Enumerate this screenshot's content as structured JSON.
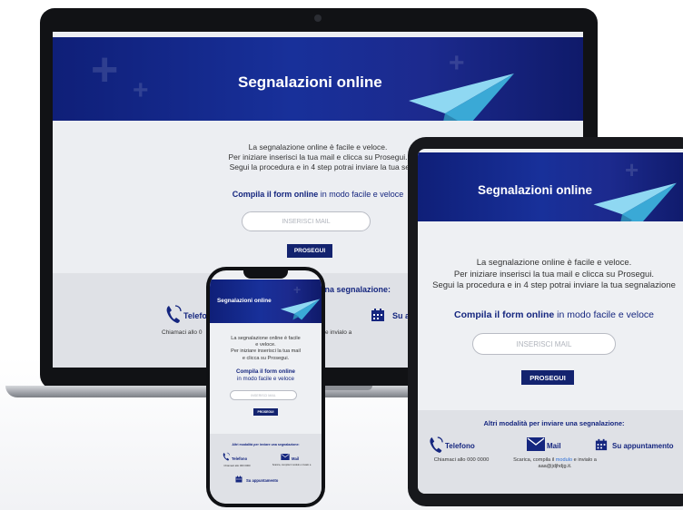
{
  "page": {
    "title": "Segnalazioni online",
    "intro_line1": "La segnalazione online è facile e veloce.",
    "intro_line2": "Per iniziare inserisci la tua mail e clicca su Prosegui.",
    "intro_line3_laptop": "Segui la procedura e in 4 step potrai inviare la tua segnalazion",
    "intro_line3": "Segui la procedura e in 4 step potrai inviare la tua segnalazione",
    "cta_bold": "Compila il form online",
    "cta_rest": " in modo facile e veloce",
    "email_placeholder": "INSERISCI MAIL",
    "submit_label": "PROSEGUI",
    "alt_title": "Altri modalità per inviare una segnalazione:",
    "alt_title_laptop_fragment": "una segnalazione:",
    "phone_label": "Telefono",
    "phone_label_laptop_fragment": "Telefo",
    "phone_desc": "Chiamaci allo 000 0000",
    "phone_desc_laptop_fragment": "Chiamaci allo 0",
    "mail_label": "Mail",
    "mail_desc_prefix": "Scarica, compila il ",
    "mail_desc_link": "modulo",
    "mail_desc_suffix": " e invialo a",
    "mail_desc_email": "aaa@jdjhdjg.it.",
    "mail_desc_laptop_fragment": "e invialo a",
    "appt_label": "Su appuntamento",
    "appt_label_laptop_fragment": "Su a",
    "phone_intro": [
      "La segnalazione online è facile",
      "e veloce.",
      "Per iniziare inserisci la tua mail",
      "e clicca su Prosegui."
    ],
    "phone_cta": [
      "Compila il form online",
      "in modo facile e veloce"
    ],
    "phone_mail_desc": "Scarica, compila il modulo e invialo a"
  },
  "colors": {
    "brand_navy": "#15267f",
    "button_navy": "#13236f",
    "link": "#2d6fd6",
    "plane_light": "#8fd8f2",
    "plane_dark": "#3aa9d6"
  },
  "icons": [
    "phone-icon",
    "mail-icon",
    "calendar-icon",
    "plus-icon",
    "paper-plane-icon"
  ]
}
